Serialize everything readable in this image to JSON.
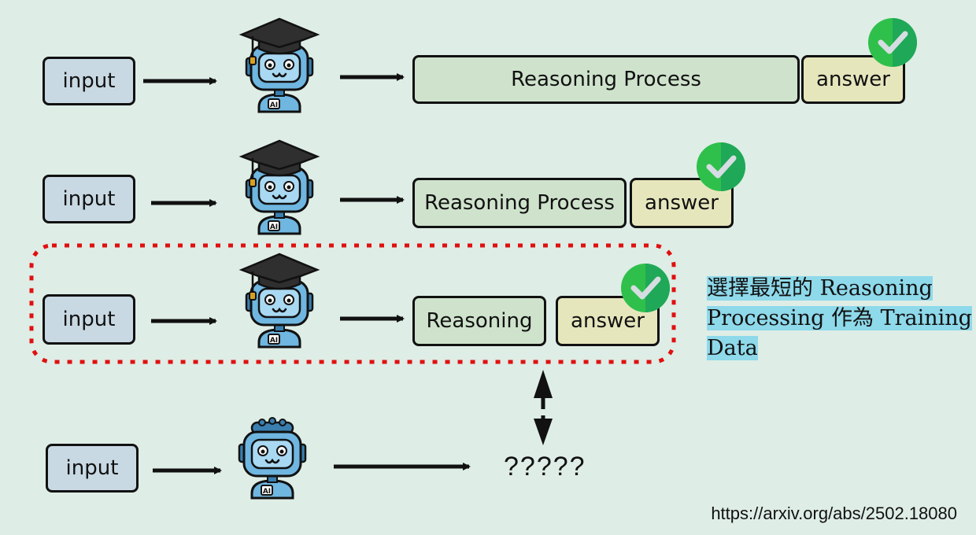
{
  "rows": [
    {
      "input": "input",
      "reasoning": "Reasoning Process",
      "answer": "answer"
    },
    {
      "input": "input",
      "reasoning": "Reasoning Process",
      "answer": "answer"
    },
    {
      "input": "input",
      "reasoning": "Reasoning",
      "answer": "answer"
    },
    {
      "input": "input",
      "output": "?????"
    }
  ],
  "robot_label": "AI",
  "note": "選擇最短的 Reasoning Processing 作為 Training Data",
  "url": "https://arxiv.org/abs/2502.18080",
  "colors": {
    "background": "#deede6",
    "input_box": "#c9d9e3",
    "reasoning_box": "#cfe3cc",
    "answer_box": "#e6e6bd",
    "check": "#2fc04b",
    "selection_border": "#e01010",
    "highlight": "#8ed9ea",
    "robot": "#6fb6e0"
  },
  "icons": [
    "robot-icon",
    "graduation-cap-icon",
    "check-icon",
    "arrow-icon",
    "double-arrow-icon"
  ]
}
